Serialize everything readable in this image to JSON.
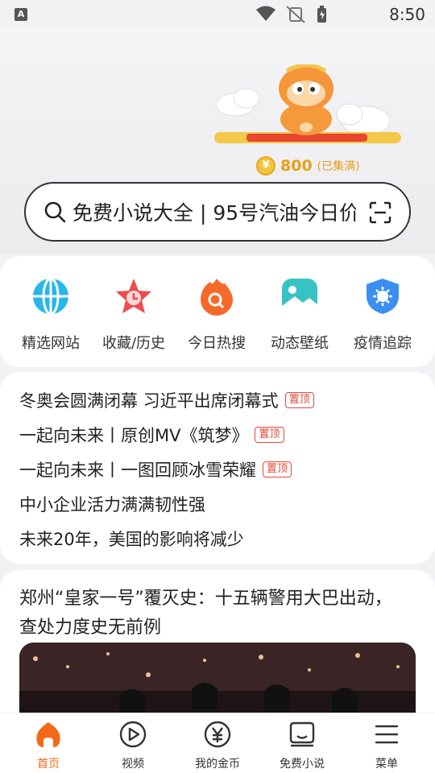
{
  "status_bar": {
    "time": "8:50",
    "notification_icon": "A"
  },
  "hero": {
    "coin_icon": "¥",
    "coin_amount": "800",
    "coin_note": "(已集满)"
  },
  "search": {
    "text": "免费小说大全 | 95号汽油今日价"
  },
  "quick_links": [
    {
      "label": "精选网站",
      "icon": "globe-icon"
    },
    {
      "label": "收藏/历史",
      "icon": "star-clock-icon"
    },
    {
      "label": "今日热搜",
      "icon": "flame-search-icon"
    },
    {
      "label": "动态壁纸",
      "icon": "wallpaper-icon"
    },
    {
      "label": "疫情追踪",
      "icon": "virus-shield-icon"
    }
  ],
  "news": [
    {
      "title": "冬奥会圆满闭幕 习近平出席闭幕式",
      "tag": "置顶"
    },
    {
      "title": "一起向未来丨原创MV《筑梦》",
      "tag": "置顶"
    },
    {
      "title": "一起向未来丨一图回顾冰雪荣耀",
      "tag": "置顶"
    },
    {
      "title": "中小企业活力满满韧性强",
      "tag": ""
    },
    {
      "title": "未来20年，美国的影响将减少",
      "tag": ""
    }
  ],
  "feed": {
    "title": "郑州“皇家一号”覆灭史：十五辆警用大巴出动，查处力度史无前例"
  },
  "tabs": [
    {
      "label": "首页",
      "icon": "home-icon",
      "active": true
    },
    {
      "label": "视频",
      "icon": "play-icon",
      "active": false
    },
    {
      "label": "我的金币",
      "icon": "coin-yen-icon",
      "active": false
    },
    {
      "label": "免费小说",
      "icon": "book-icon",
      "active": false
    },
    {
      "label": "菜单",
      "icon": "menu-icon",
      "active": false
    }
  ],
  "colors": {
    "accent": "#f26a19",
    "coin": "#e6a019",
    "pin": "#e3473b"
  }
}
